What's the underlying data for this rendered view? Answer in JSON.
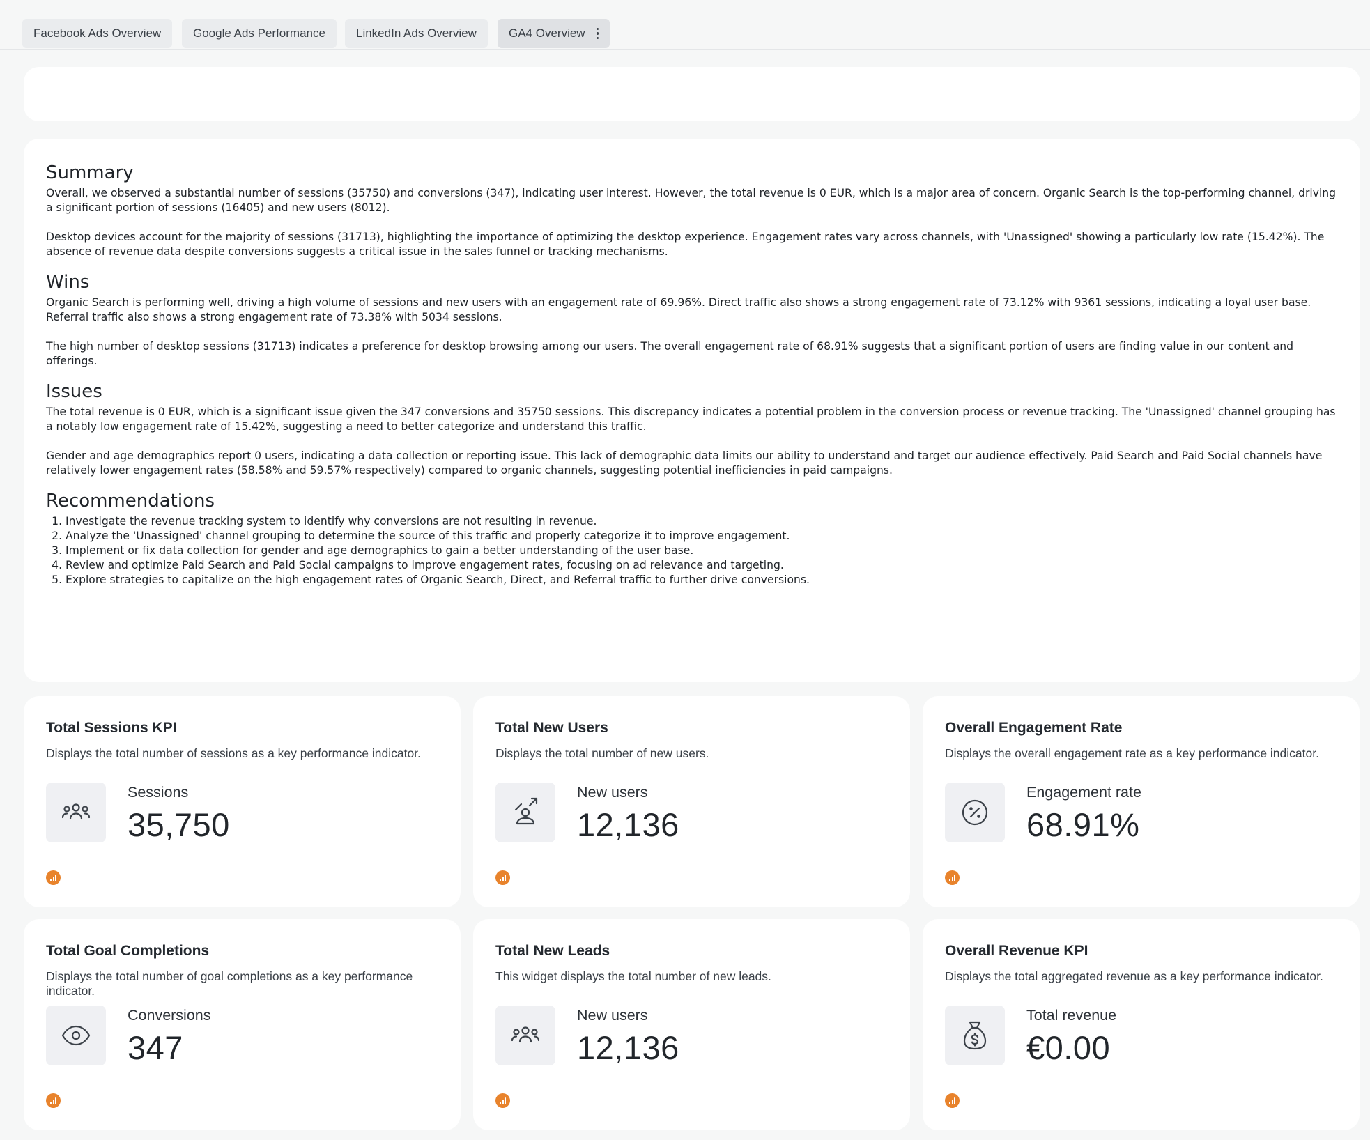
{
  "tabs": [
    {
      "label": "Facebook Ads Overview"
    },
    {
      "label": "Google Ads Performance"
    },
    {
      "label": "LinkedIn Ads Overview"
    },
    {
      "label": "GA4 Overview"
    }
  ],
  "summary": {
    "summary_heading": "Summary",
    "summary_p1": "Overall, we observed a substantial number of sessions (35750) and conversions (347), indicating user interest. However, the total revenue is 0 EUR, which is a major area of concern. Organic Search is the top-performing channel, driving a significant portion of sessions (16405) and new users (8012).",
    "summary_p2": "Desktop devices account for the majority of sessions (31713), highlighting the importance of optimizing the desktop experience. Engagement rates vary across channels, with 'Unassigned' showing a particularly low rate (15.42%). The absence of revenue data despite conversions suggests a critical issue in the sales funnel or tracking mechanisms.",
    "wins_heading": "Wins",
    "wins_p1": "Organic Search is performing well, driving a high volume of sessions and new users with an engagement rate of 69.96%. Direct traffic also shows a strong engagement rate of 73.12% with 9361 sessions, indicating a loyal user base. Referral traffic also shows a strong engagement rate of 73.38% with 5034 sessions.",
    "wins_p2": "The high number of desktop sessions (31713) indicates a preference for desktop browsing among our users. The overall engagement rate of 68.91% suggests that a significant portion of users are finding value in our content and offerings.",
    "issues_heading": "Issues",
    "issues_p1": "The total revenue is 0 EUR, which is a significant issue given the 347 conversions and 35750 sessions. This discrepancy indicates a potential problem in the conversion process or revenue tracking. The 'Unassigned' channel grouping has a notably low engagement rate of 15.42%, suggesting a need to better categorize and understand this traffic.",
    "issues_p2": "Gender and age demographics report 0 users, indicating a data collection or reporting issue. This lack of demographic data limits our ability to understand and target our audience effectively. Paid Search and Paid Social channels have relatively lower engagement rates (58.58% and 59.57% respectively) compared to organic channels, suggesting potential inefficiencies in paid campaigns.",
    "recommendations_heading": "Recommendations",
    "recommendations": [
      "Investigate the revenue tracking system to identify why conversions are not resulting in revenue.",
      "Analyze the 'Unassigned' channel grouping to determine the source of this traffic and properly categorize it to improve engagement.",
      "Implement or fix data collection for gender and age demographics to gain a better understanding of the user base.",
      "Review and optimize Paid Search and Paid Social campaigns to improve engagement rates, focusing on ad relevance and targeting.",
      "Explore strategies to capitalize on the high engagement rates of Organic Search, Direct, and Referral traffic to further drive conversions."
    ]
  },
  "kpis": [
    {
      "title": "Total Sessions KPI",
      "description": "Displays the total number of sessions as a key performance indicator.",
      "label": "Sessions",
      "value": "35,750",
      "icon": "users-group-icon"
    },
    {
      "title": "Total New Users",
      "description": "Displays the total number of new users.",
      "label": "New users",
      "value": "12,136",
      "icon": "user-arrow-icon"
    },
    {
      "title": "Overall Engagement Rate",
      "description": "Displays the overall engagement rate as a key performance indicator.",
      "label": "Engagement rate",
      "value": "68.91%",
      "icon": "percent-badge-icon"
    },
    {
      "title": "Total Goal Completions",
      "description": "Displays the total number of goal completions as a key performance indicator.",
      "label": "Conversions",
      "value": "347",
      "icon": "eye-icon"
    },
    {
      "title": "Total New Leads",
      "description": "This widget displays the total number of new leads.",
      "label": "New users",
      "value": "12,136",
      "icon": "users-group-icon"
    },
    {
      "title": "Overall Revenue KPI",
      "description": "Displays the total aggregated revenue as a key performance indicator.",
      "label": "Total revenue",
      "value": "€0.00",
      "icon": "money-bag-icon"
    }
  ],
  "colors": {
    "source_badge": "#e8832c",
    "icon_tile": "#eff0f3"
  }
}
